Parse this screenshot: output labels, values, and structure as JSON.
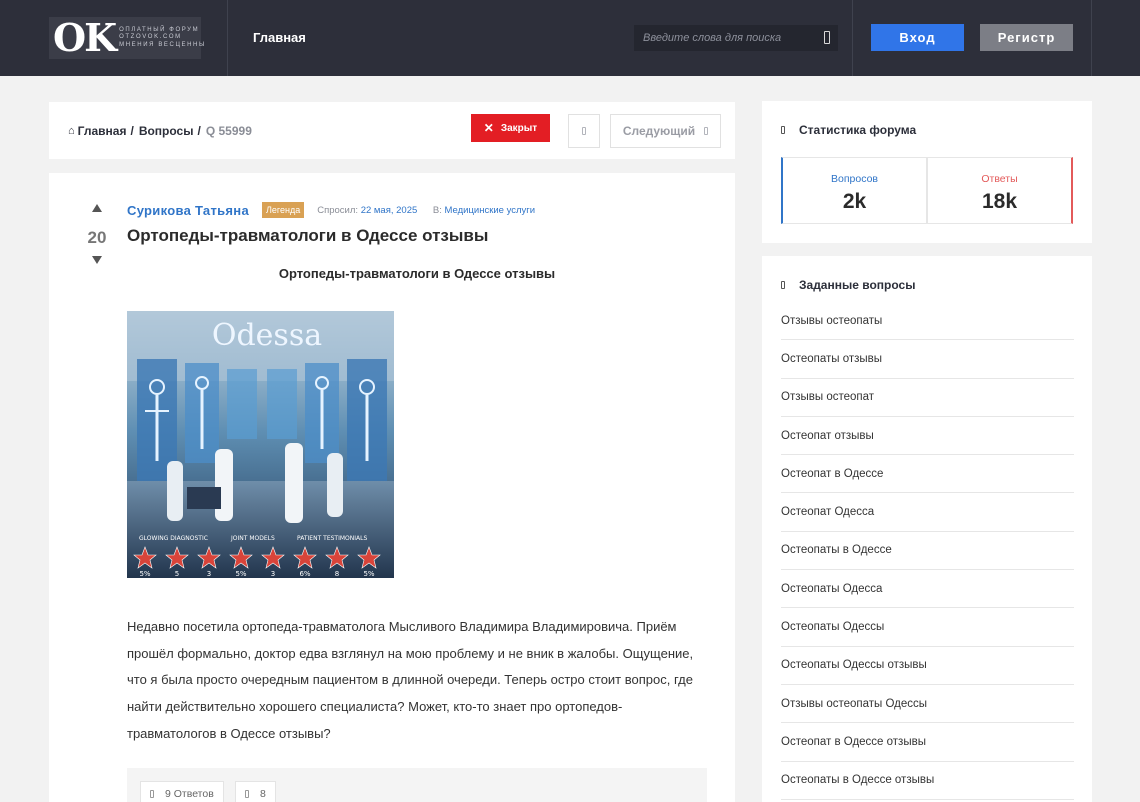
{
  "header": {
    "logo": {
      "mark": "OK",
      "lines": [
        "ОПЛАТНЫЙ ФОРУМ",
        "OTZOVOK.COM",
        "МНЕНИЯ ВЕСЦЕННЫ"
      ]
    },
    "nav_home": "Главная",
    "search_placeholder": "Введите слова для поиска",
    "login_label": "Вход",
    "register_label": "Регистр",
    "colors": {
      "background": "#2d2f3a",
      "login": "#3075e8",
      "register": "#7c7e86"
    }
  },
  "breadcrumb": {
    "home_icon": "home-icon",
    "home": "Главная",
    "questions": "Вопросы",
    "current": "Q 55999",
    "separator": "/"
  },
  "actions": {
    "closed_label": "Закрыт",
    "closed_icon": "close-icon",
    "prev_icon": "chevron-left-icon",
    "next_label": "Следующий",
    "next_icon": "chevron-right-icon",
    "closed_color": "#e31e24"
  },
  "question": {
    "votes": "20",
    "author": "Сурикова Татьяна",
    "badge": "Легенда",
    "asked_label": "Спросил:",
    "asked_date": "22 мая, 2025",
    "in_label": "В:",
    "category": "Медицинские услуги",
    "title": "Ортопеды-травматологи в Одессе отзывы",
    "content_heading": "Ортопеды-травматологи в Одессе отзывы",
    "image": {
      "sign": "Odessa",
      "panel_labels": [
        "GLOWING DIAGNOSTIC",
        "JOINT MODELS",
        "PATIENT TESTIMONIALS"
      ],
      "star_labels": [
        "5%",
        "5",
        "3",
        "5%",
        "3",
        "6%",
        "8",
        "5%"
      ]
    },
    "body": "Недавно посетила ортопеда-травматолога Мысливого Владимира Владимировича. Приём прошёл формально, доктор едва взглянул на мою проблему и не вник в жалобы. Ощущение, что я была просто очередным пациентом в длинной очереди. Теперь остро стоит вопрос, где найти действительно хорошего специалиста? Может, кто-то знает про ортопедов-травматологов в Одессе отзывы?",
    "answers_count": "9 Ответов",
    "views_count": "8"
  },
  "stats": {
    "title": "Статистика форума",
    "questions_label": "Вопросов",
    "questions_value": "2k",
    "answers_label": "Ответы",
    "answers_value": "18k",
    "questions_color": "#3075c8",
    "answers_color": "#e35a5a"
  },
  "asked": {
    "title": "Заданные вопросы",
    "items": [
      "Отзывы остеопаты",
      "Остеопаты отзывы",
      "Отзывы остеопат",
      "Остеопат отзывы",
      "Остеопат в Одессе",
      "Остеопат Одесса",
      "Остеопаты в Одессе",
      "Остеопаты Одесса",
      "Остеопаты Одессы",
      "Остеопаты Одессы отзывы",
      "Отзывы остеопаты Одессы",
      "Остеопат в Одессе отзывы",
      "Остеопаты в Одессе отзывы"
    ]
  }
}
